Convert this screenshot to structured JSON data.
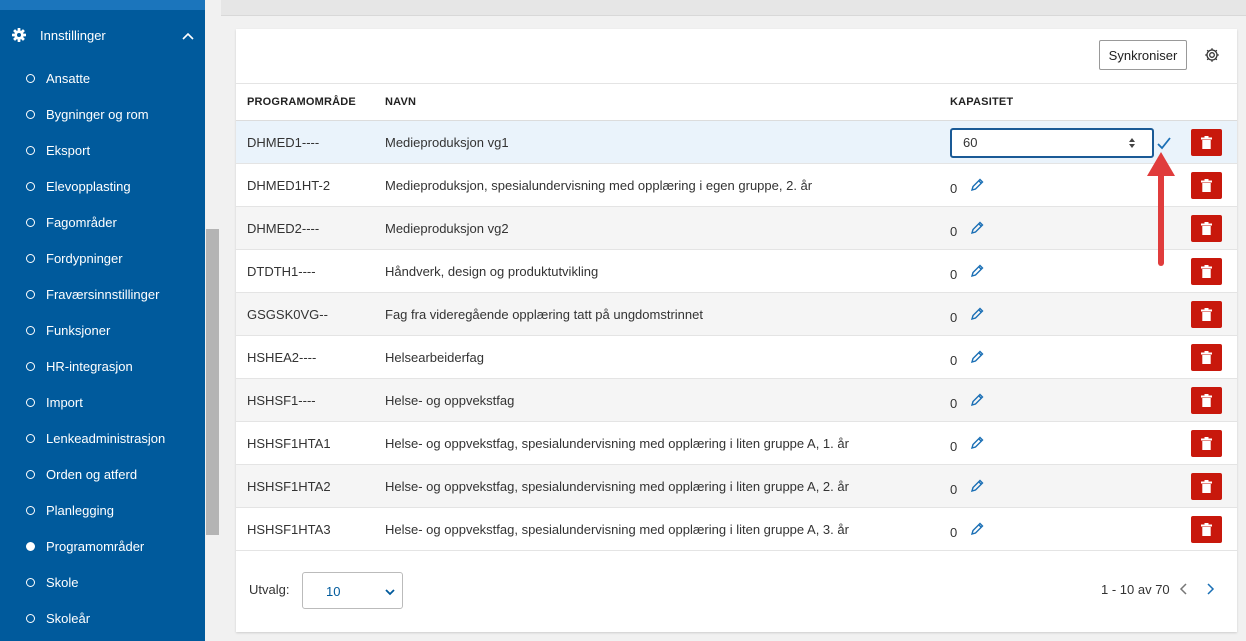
{
  "sidebar": {
    "section_label": "Innstillinger",
    "items": [
      {
        "label": "Ansatte"
      },
      {
        "label": "Bygninger og rom"
      },
      {
        "label": "Eksport"
      },
      {
        "label": "Elevopplasting"
      },
      {
        "label": "Fagområder"
      },
      {
        "label": "Fordypninger"
      },
      {
        "label": "Fraværsinnstillinger"
      },
      {
        "label": "Funksjoner"
      },
      {
        "label": "HR-integrasjon"
      },
      {
        "label": "Import"
      },
      {
        "label": "Lenkeadministrasjon"
      },
      {
        "label": "Orden og atferd"
      },
      {
        "label": "Planlegging"
      },
      {
        "label": "Programområder",
        "active": true
      },
      {
        "label": "Skole"
      },
      {
        "label": "Skoleår"
      }
    ]
  },
  "toolbar": {
    "sync_label": "Synkroniser"
  },
  "table": {
    "headers": {
      "code": "PROGRAMOMRÅDE",
      "name": "NAVN",
      "capacity": "KAPASITET"
    },
    "rows": [
      {
        "code": "DHMED1----",
        "name": "Medieproduksjon vg1",
        "capacity": "60",
        "editing": true
      },
      {
        "code": "DHMED1HT-2",
        "name": "Medieproduksjon, spesialundervisning med opplæring i egen gruppe, 2. år",
        "capacity": "0"
      },
      {
        "code": "DHMED2----",
        "name": "Medieproduksjon vg2",
        "capacity": "0"
      },
      {
        "code": "DTDTH1----",
        "name": "Håndverk, design og produktutvikling",
        "capacity": "0"
      },
      {
        "code": "GSGSK0VG--",
        "name": "Fag fra videregående opplæring tatt på ungdomstrinnet",
        "capacity": "0"
      },
      {
        "code": "HSHEA2----",
        "name": "Helsearbeiderfag",
        "capacity": "0"
      },
      {
        "code": "HSHSF1----",
        "name": "Helse- og oppvekstfag",
        "capacity": "0"
      },
      {
        "code": "HSHSF1HTA1",
        "name": "Helse- og oppvekstfag, spesialundervisning med opplæring i liten gruppe A, 1. år",
        "capacity": "0"
      },
      {
        "code": "HSHSF1HTA2",
        "name": "Helse- og oppvekstfag, spesialundervisning med opplæring i liten gruppe A, 2. år",
        "capacity": "0"
      },
      {
        "code": "HSHSF1HTA3",
        "name": "Helse- og oppvekstfag, spesialundervisning med opplæring i liten gruppe A, 3. år",
        "capacity": "0"
      }
    ]
  },
  "footer": {
    "page_size_label": "Utvalg:",
    "page_size_value": "10",
    "pagination_text": "1 - 10 av 70"
  },
  "colors": {
    "sidebar_bg": "#005a9c",
    "accent": "#1a5a96",
    "delete": "#c8180c",
    "annotation_arrow": "#e03c3c"
  }
}
